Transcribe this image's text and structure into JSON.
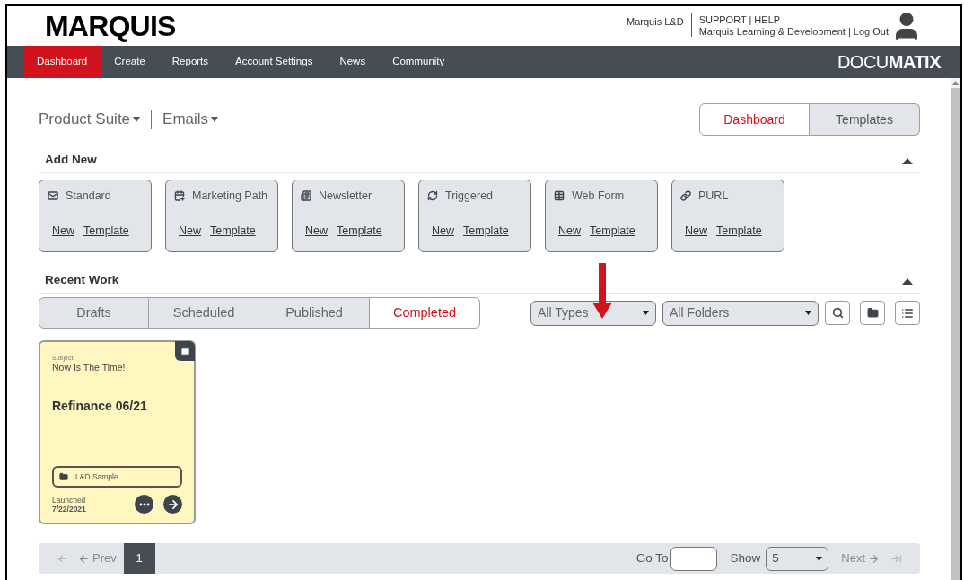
{
  "header": {
    "logo": "MARQUIS",
    "user": "Marquis L&D",
    "support_line": "SUPPORT | HELP",
    "org_line": "Marquis Learning & Development | Log Out"
  },
  "nav": {
    "items": [
      {
        "label": "Dashboard",
        "selected": true
      },
      {
        "label": "Create",
        "selected": false
      },
      {
        "label": "Reports",
        "selected": false
      },
      {
        "label": "Account Settings",
        "selected": false
      },
      {
        "label": "News",
        "selected": false
      },
      {
        "label": "Community",
        "selected": false
      }
    ],
    "brand": "DOCU**MATIX**"
  },
  "breadcrumb": [
    "Product Suite",
    "Emails"
  ],
  "view_toggle": [
    {
      "label": "Dashboard",
      "selected": true
    },
    {
      "label": "Templates",
      "selected": false
    }
  ],
  "add_new": {
    "title": "Add New",
    "expanded": true,
    "cards": [
      {
        "kind": "standard",
        "label": "Standard",
        "links": [
          "New",
          "Template"
        ]
      },
      {
        "kind": "path",
        "label": "Marketing Path",
        "links": [
          "New",
          "Template"
        ]
      },
      {
        "kind": "newsletter",
        "label": "Newsletter",
        "links": [
          "New",
          "Template"
        ]
      },
      {
        "kind": "triggered",
        "label": "Triggered",
        "links": [
          "New",
          "Template"
        ]
      },
      {
        "kind": "webform",
        "label": "Web Form",
        "links": [
          "New",
          "Template"
        ]
      },
      {
        "kind": "purl",
        "label": "PURL",
        "links": [
          "New",
          "Template"
        ]
      }
    ]
  },
  "recent_work": {
    "title": "Recent Work",
    "expanded": true,
    "tabs": [
      {
        "label": "Drafts",
        "selected": false
      },
      {
        "label": "Scheduled",
        "selected": false
      },
      {
        "label": "Published",
        "selected": false
      },
      {
        "label": "Completed",
        "selected": true
      }
    ],
    "type_filter": "All Types",
    "folder_filter": "All Folders",
    "items": [
      {
        "subject_label": "Subject",
        "subject": "Now Is The Time!",
        "name": "Refinance 06/21",
        "folder": "L&D Sample",
        "status_label": "Launched",
        "date": "7/22/2021"
      }
    ]
  },
  "pagination": {
    "prev": "Prev",
    "prev_disabled": true,
    "pages": [
      {
        "label": "1",
        "selected": true
      }
    ],
    "go_to_label": "Go To",
    "show_label": "Show",
    "show_value": "5",
    "next": "Next",
    "next_disabled": true
  }
}
